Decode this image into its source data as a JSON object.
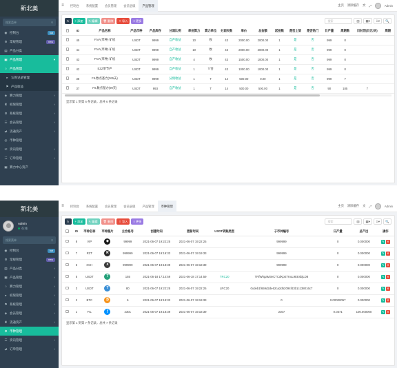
{
  "common": {
    "brand": "新北美",
    "search_placeholder": "搜索菜单",
    "menu_toggle": "≡",
    "search_box": "搜索",
    "admin_name": "Admin",
    "top_tabs_common": [
      "控制台",
      "系统配置",
      "会员管理",
      "会员层级",
      "产品管理"
    ],
    "top_right": [
      "主页",
      "清除缓存",
      "文",
      "⤢"
    ],
    "toolbar": {
      "refresh": "↻",
      "add": "+ 添加",
      "edit": "✎ 编辑",
      "delete": "🗑 删除",
      "import": "⇪ 导入",
      "more": "≡ 更多"
    },
    "icon_btns": [
      "▥",
      "▦▾",
      "⇩▾",
      "🔍"
    ]
  },
  "shot1": {
    "sidebar": [
      {
        "label": "控制台",
        "badge": "hot",
        "badge_color": "#3c8dbc"
      },
      {
        "label": "常规管理",
        "badge": "new",
        "badge_color": "#605ca8"
      },
      {
        "label": "产品分类"
      },
      {
        "label": "产品管理",
        "arrow": "▾",
        "active": true
      },
      {
        "label": "产品管理",
        "active": true
      },
      {
        "label": "认购记录管理",
        "sub": true
      },
      {
        "label": "产品收益",
        "sub": true
      },
      {
        "label": "算力管理",
        "arrow": "‹"
      },
      {
        "label": "权限管理",
        "arrow": "‹"
      },
      {
        "label": "系统管理",
        "arrow": "‹"
      },
      {
        "label": "会员管理",
        "arrow": "‹"
      },
      {
        "label": "流通资产",
        "arrow": "‹"
      },
      {
        "label": "币种管理"
      },
      {
        "label": "资讯管理",
        "arrow": "‹"
      },
      {
        "label": "订单管理",
        "arrow": "‹"
      },
      {
        "label": "算力中心资产"
      }
    ],
    "tab_active": "产品管理",
    "columns": [
      "",
      "ID",
      "产品名称",
      "产品币种",
      "产品库存",
      "分润比例",
      "单份算力",
      "算力单位",
      "分润天数",
      "单价",
      "总金额",
      "起投数",
      "是否上架",
      "是否热门",
      "日产量",
      "周期数",
      "日封顶(日元/天)",
      "周期"
    ],
    "rows": [
      [
        "",
        "45",
        "FIVA(币种) 矿机",
        "USDT",
        "9999",
        "自产收益",
        "10",
        "枚",
        "43",
        "2000.00",
        "2000.00",
        "1",
        "是",
        "否",
        "999",
        "0",
        "",
        ""
      ],
      [
        "",
        "44",
        "FIVA(币种) 矿机",
        "USDT",
        "9999",
        "自产收益",
        "10",
        "枚",
        "43",
        "2000.00",
        "2000.00",
        "1",
        "是",
        "否",
        "999",
        "0",
        "",
        ""
      ],
      [
        "",
        "43",
        "FIVA(币种) 矿机",
        "USDT",
        "9999",
        "自产收益",
        "4",
        "枚",
        "43",
        "1500.00",
        "1000.00",
        "1",
        "是",
        "否",
        "999",
        "0",
        "",
        ""
      ],
      [
        "",
        "42",
        "EZZ单节产",
        "USDT",
        "9999",
        "自产收益",
        "1",
        "T/台",
        "43",
        "1000.00",
        "1000.00",
        "1",
        "是",
        "否",
        "999",
        "0",
        "",
        ""
      ],
      [
        "",
        "38",
        "FIL数点基力(365天)",
        "USDT",
        "9999",
        "分佣收益",
        "1",
        "T",
        "14",
        "500.00",
        "0.00",
        "1",
        "是",
        "否",
        "999",
        "7",
        "",
        ""
      ],
      [
        "",
        "37",
        "FIL数点基力(90天)",
        "USDT",
        "993",
        "自产收益",
        "1",
        "T",
        "14",
        "500.00",
        "500.00",
        "1",
        "是",
        "否",
        "90",
        "185",
        "7",
        ""
      ]
    ],
    "footer": "显示第 1 到第 6 条记录，总共 6 条记录"
  },
  "shot2": {
    "user": {
      "name": "Admin",
      "status": "在线"
    },
    "sidebar": [
      {
        "label": "控制台",
        "badge": "hot",
        "badge_color": "#3c8dbc"
      },
      {
        "label": "常规管理",
        "badge": "new",
        "badge_color": "#605ca8"
      },
      {
        "label": "产品分类",
        "arrow": "‹"
      },
      {
        "label": "产品管理",
        "arrow": "‹"
      },
      {
        "label": "算力管理",
        "arrow": "‹"
      },
      {
        "label": "权限管理",
        "arrow": "‹"
      },
      {
        "label": "系统管理",
        "arrow": "‹"
      },
      {
        "label": "会员管理",
        "arrow": "‹"
      },
      {
        "label": "流通资产",
        "arrow": "‹"
      },
      {
        "label": "币种管理",
        "active": true
      },
      {
        "label": "资讯管理",
        "arrow": "‹"
      },
      {
        "label": "订单管理",
        "arrow": "‹"
      }
    ],
    "tab_extra": "币种管理",
    "columns": [
      "",
      "ID",
      "币种名称",
      "币种图片",
      "主合格号",
      "创建时间",
      "更新时间",
      "USDT转账类型",
      "子币种编号",
      "日产量",
      "总产出",
      "操作"
    ],
    "rows": [
      {
        "id": "8",
        "name": "VIP",
        "img": "◆",
        "img_color": "#1a1a1a",
        "code": "99999",
        "created": "2021-06-07 19:22:25",
        "updated": "2021-06-07 19:22:25",
        "type": "",
        "addr": "999999",
        "daily": "0",
        "total": "0.000000"
      },
      {
        "id": "7",
        "name": "RZT",
        "img": "R",
        "img_color": "#2b2b2b",
        "code": "999999",
        "created": "2021-06-07 19:19:33",
        "updated": "2021-06-07 19:19:33",
        "type": "",
        "addr": "999999",
        "daily": "0",
        "total": "0.000000"
      },
      {
        "id": "6",
        "name": "XCH",
        "img": "X",
        "img_color": "#3a3a3a",
        "code": "999999",
        "created": "2021-06-07 19:18:39",
        "updated": "2021-06-07 19:18:39",
        "type": "",
        "addr": "999999",
        "daily": "0",
        "total": "0.000000"
      },
      {
        "id": "5",
        "name": "USDT",
        "img": "T",
        "img_color": "#26a17b",
        "code": "155",
        "created": "2021-06-18 17:14:59",
        "updated": "2021-06-18 17:14:59",
        "type": "TRC20",
        "addr": "TRfWhgaM3eCTCdKpETKuL9EEsbjLD8",
        "daily": "0",
        "total": "0.000000"
      },
      {
        "id": "3",
        "name": "USDT",
        "img": "T",
        "img_color": "#3a8fd6",
        "code": "80",
        "created": "2021-06-07 19:22:25",
        "updated": "2021-06-07 19:22:25",
        "type": "LRC20",
        "addr": "0xdeb1f659d2de62ca2d52094f43b1c138016c7",
        "daily": "0",
        "total": "0.000000"
      },
      {
        "id": "2",
        "name": "BTC",
        "img": "₿",
        "img_color": "#f7931a",
        "code": "6",
        "created": "2021-06-07 19:19:33",
        "updated": "2021-06-07 19:19:33",
        "type": "",
        "addr": "0",
        "daily": "0.00000057",
        "total": "0.000000"
      },
      {
        "id": "1",
        "name": "FIL",
        "img": "ƒ",
        "img_color": "#0090ff",
        "code": "2301",
        "created": "2021-06-07 19:18:39",
        "updated": "2021-06-07 19:18:39",
        "type": "",
        "addr": "2307",
        "daily": "0.0371",
        "total": "100.000000"
      }
    ],
    "footer": "显示第 1 到第 7 条记录，总共 7 条记录"
  }
}
